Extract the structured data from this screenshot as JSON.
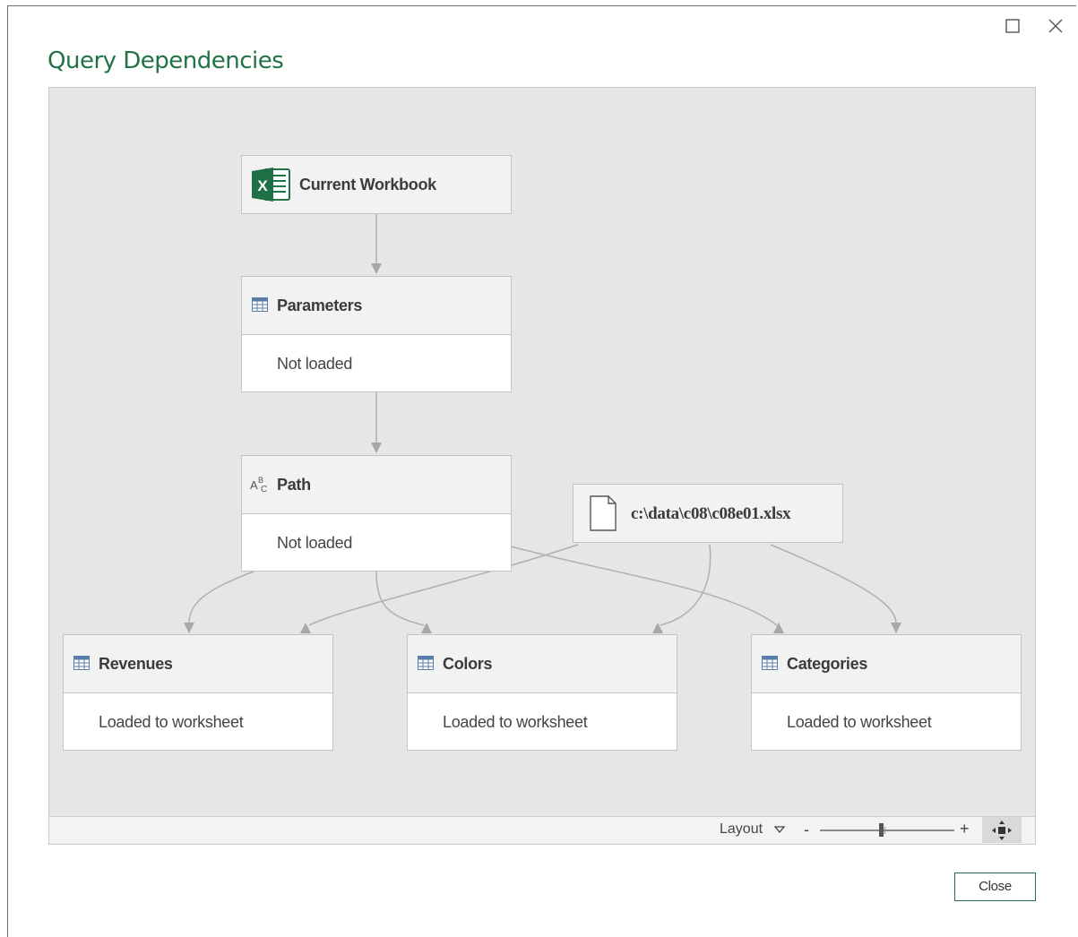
{
  "window": {
    "title": "Query Dependencies",
    "maximize_icon": "maximize-icon",
    "close_icon": "close-icon"
  },
  "nodes": {
    "current_workbook": {
      "title": "Current Workbook",
      "icon": "excel-icon"
    },
    "parameters": {
      "title": "Parameters",
      "status": "Not loaded",
      "icon": "table-icon"
    },
    "path": {
      "title": "Path",
      "status": "Not loaded",
      "icon": "text-type-icon"
    },
    "file": {
      "title": "c:\\data\\c08\\c08e01.xlsx",
      "icon": "file-icon"
    },
    "revenues": {
      "title": "Revenues",
      "status": "Loaded to worksheet",
      "icon": "table-icon"
    },
    "colors": {
      "title": "Colors",
      "status": "Loaded to worksheet",
      "icon": "table-icon"
    },
    "categories": {
      "title": "Categories",
      "status": "Loaded to worksheet",
      "icon": "table-icon"
    }
  },
  "statusbar": {
    "layout_label": "Layout",
    "zoom_minus": "-",
    "zoom_plus": "+",
    "zoom_level": 0.45,
    "fit_icon": "fit-to-screen-icon"
  },
  "footer": {
    "close_label": "Close"
  },
  "colors": {
    "accent": "#217346",
    "canvas": "#e6e6e6",
    "node_header": "#f2f2f2",
    "connector": "#a8a8a8"
  }
}
